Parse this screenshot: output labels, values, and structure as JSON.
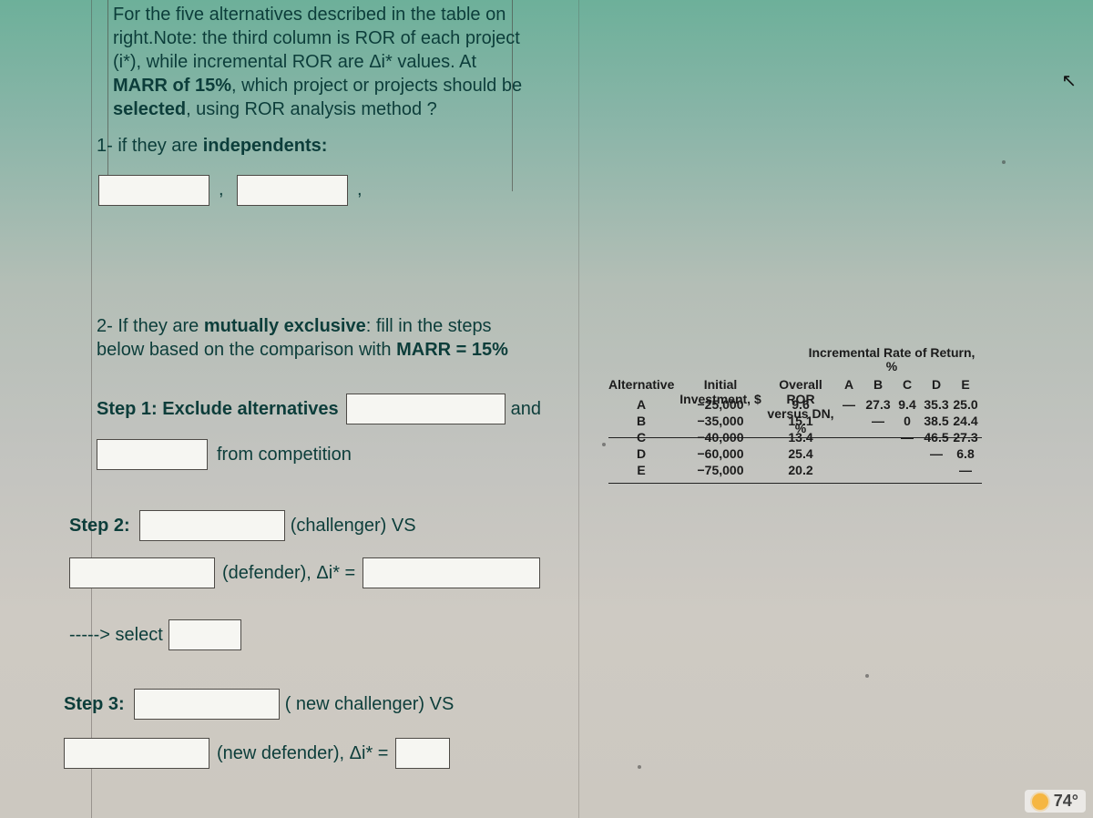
{
  "question": {
    "line1": "For the five alternatives described in the table on",
    "line2": "right.Note: the third column is ROR of each project",
    "line3": "(i*), while incremental ROR  are Δi* values. At",
    "line4a": "MARR of 15%",
    "line4b": ", which project or projects should be",
    "line5a": "selected",
    "line5b": ", using ROR analysis method  ?",
    "part1a": "1- if they are ",
    "part1b": "independents:",
    "part2a": "2- If they are ",
    "part2b": "mutually exclusive",
    "part2c": ": fill in the steps",
    "part2d": "below based on the comparison with ",
    "part2e": "MARR = 15%"
  },
  "steps": {
    "s1a": "Step 1:  Exclude alternatives",
    "s1and": "and",
    "s1b": "from competition",
    "s2": "Step 2:",
    "s2chal": "(challenger) VS",
    "s2def": "(defender),  Δi* =",
    "s2sel": "-----> select",
    "s3": "Step 3:",
    "s3chal": "( new challenger) VS",
    "s3def": "(new defender), Δi* ="
  },
  "table": {
    "incr_title": "Incremental Rate of Return, %",
    "h_alt": "Alternative",
    "h_inv": "Initial Investment, $",
    "h_ror": "Overall ROR versus DN, %",
    "cols": [
      "A",
      "B",
      "C",
      "D",
      "E"
    ],
    "rows": [
      {
        "alt": "A",
        "inv": "−25,000",
        "ror": "9.6",
        "inc": [
          "—",
          "27.3",
          "9.4",
          "35.3",
          "25.0"
        ]
      },
      {
        "alt": "B",
        "inv": "−35,000",
        "ror": "15.1",
        "inc": [
          "",
          "—",
          "0",
          "38.5",
          "24.4"
        ]
      },
      {
        "alt": "C",
        "inv": "−40,000",
        "ror": "13.4",
        "inc": [
          "",
          "",
          "—",
          "46.5",
          "27.3"
        ]
      },
      {
        "alt": "D",
        "inv": "−60,000",
        "ror": "25.4",
        "inc": [
          "",
          "",
          "",
          "—",
          "6.8"
        ]
      },
      {
        "alt": "E",
        "inv": "−75,000",
        "ror": "20.2",
        "inc": [
          "",
          "",
          "",
          "",
          "—"
        ]
      }
    ]
  },
  "temp": "74°"
}
